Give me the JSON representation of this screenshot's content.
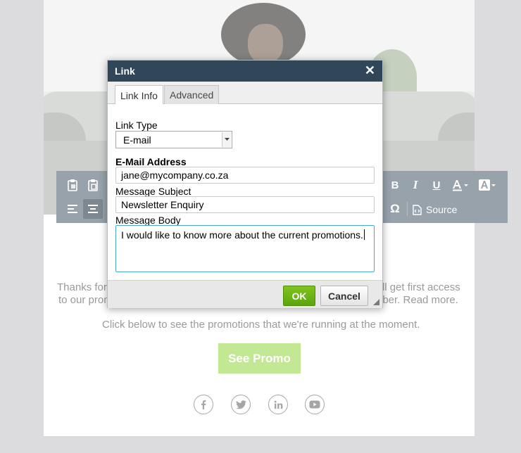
{
  "toolbar": {
    "source_label": "Source"
  },
  "email": {
    "intro_line1_left": "Thanks for",
    "intro_line1_right": "'ll get first access",
    "intro_line2_left": "to our prom",
    "intro_line2_right": "iber. Read more.",
    "promo_text": "Click below to see the promotions that we're running at the moment.",
    "promo_button": "See Promo",
    "social_icons": [
      "facebook-icon",
      "twitter-icon",
      "linkedin-icon",
      "youtube-icon"
    ],
    "promo_color": "#c3e893"
  },
  "dialog": {
    "title": "Link",
    "close_glyph": "✕",
    "tabs": [
      {
        "label": "Link Info",
        "active": true
      },
      {
        "label": "Advanced",
        "active": false
      }
    ],
    "link_type_label": "Link Type",
    "link_type_value": "E-mail",
    "email_label": "E-Mail Address",
    "email_value": "jane@mycompany.co.za",
    "subject_label": "Message Subject",
    "subject_value": "Newsletter Enquiry",
    "body_label": "Message Body",
    "body_value": "I would like to know more about the current promotions.",
    "ok_label": "OK",
    "cancel_label": "Cancel",
    "title_bar_color": "#32465a",
    "ok_color": "#6cb416"
  }
}
